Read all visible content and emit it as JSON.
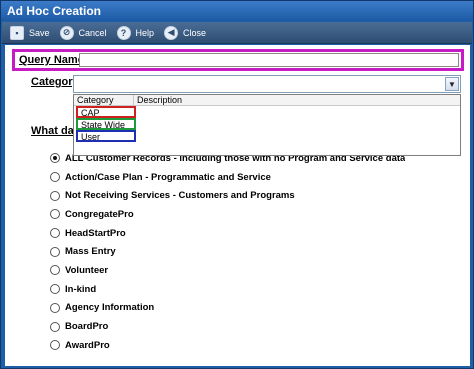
{
  "window": {
    "title": "Ad Hoc Creation"
  },
  "toolbar": {
    "save_label": "Save",
    "cancel_label": "Cancel",
    "help_label": "Help",
    "close_label": "Close"
  },
  "form": {
    "query_name_label": "Query Name",
    "query_name_value": "",
    "category_label": "Category",
    "category_value": "",
    "what_label": "What data"
  },
  "dropdown": {
    "col_category": "Category",
    "col_description": "Description",
    "items": [
      "CAP",
      "State Wide",
      "User"
    ]
  },
  "options": [
    {
      "label": "ALL Customer Records - including those with no Program and Service data",
      "selected": true
    },
    {
      "label": "Action/Case Plan - Programmatic and Service",
      "selected": false
    },
    {
      "label": "Not Receiving Services - Customers and Programs",
      "selected": false
    },
    {
      "label": "CongregatePro",
      "selected": false
    },
    {
      "label": "HeadStartPro",
      "selected": false
    },
    {
      "label": "Mass Entry",
      "selected": false
    },
    {
      "label": "Volunteer",
      "selected": false
    },
    {
      "label": "In-kind",
      "selected": false
    },
    {
      "label": "Agency Information",
      "selected": false
    },
    {
      "label": "BoardPro",
      "selected": false
    },
    {
      "label": "AwardPro",
      "selected": false
    }
  ],
  "colors": {
    "query_highlight": "#c61bc6",
    "cap_highlight": "#cf1f1f",
    "statewide_highlight": "#1c9a3c",
    "user_highlight": "#1f2fb3"
  }
}
